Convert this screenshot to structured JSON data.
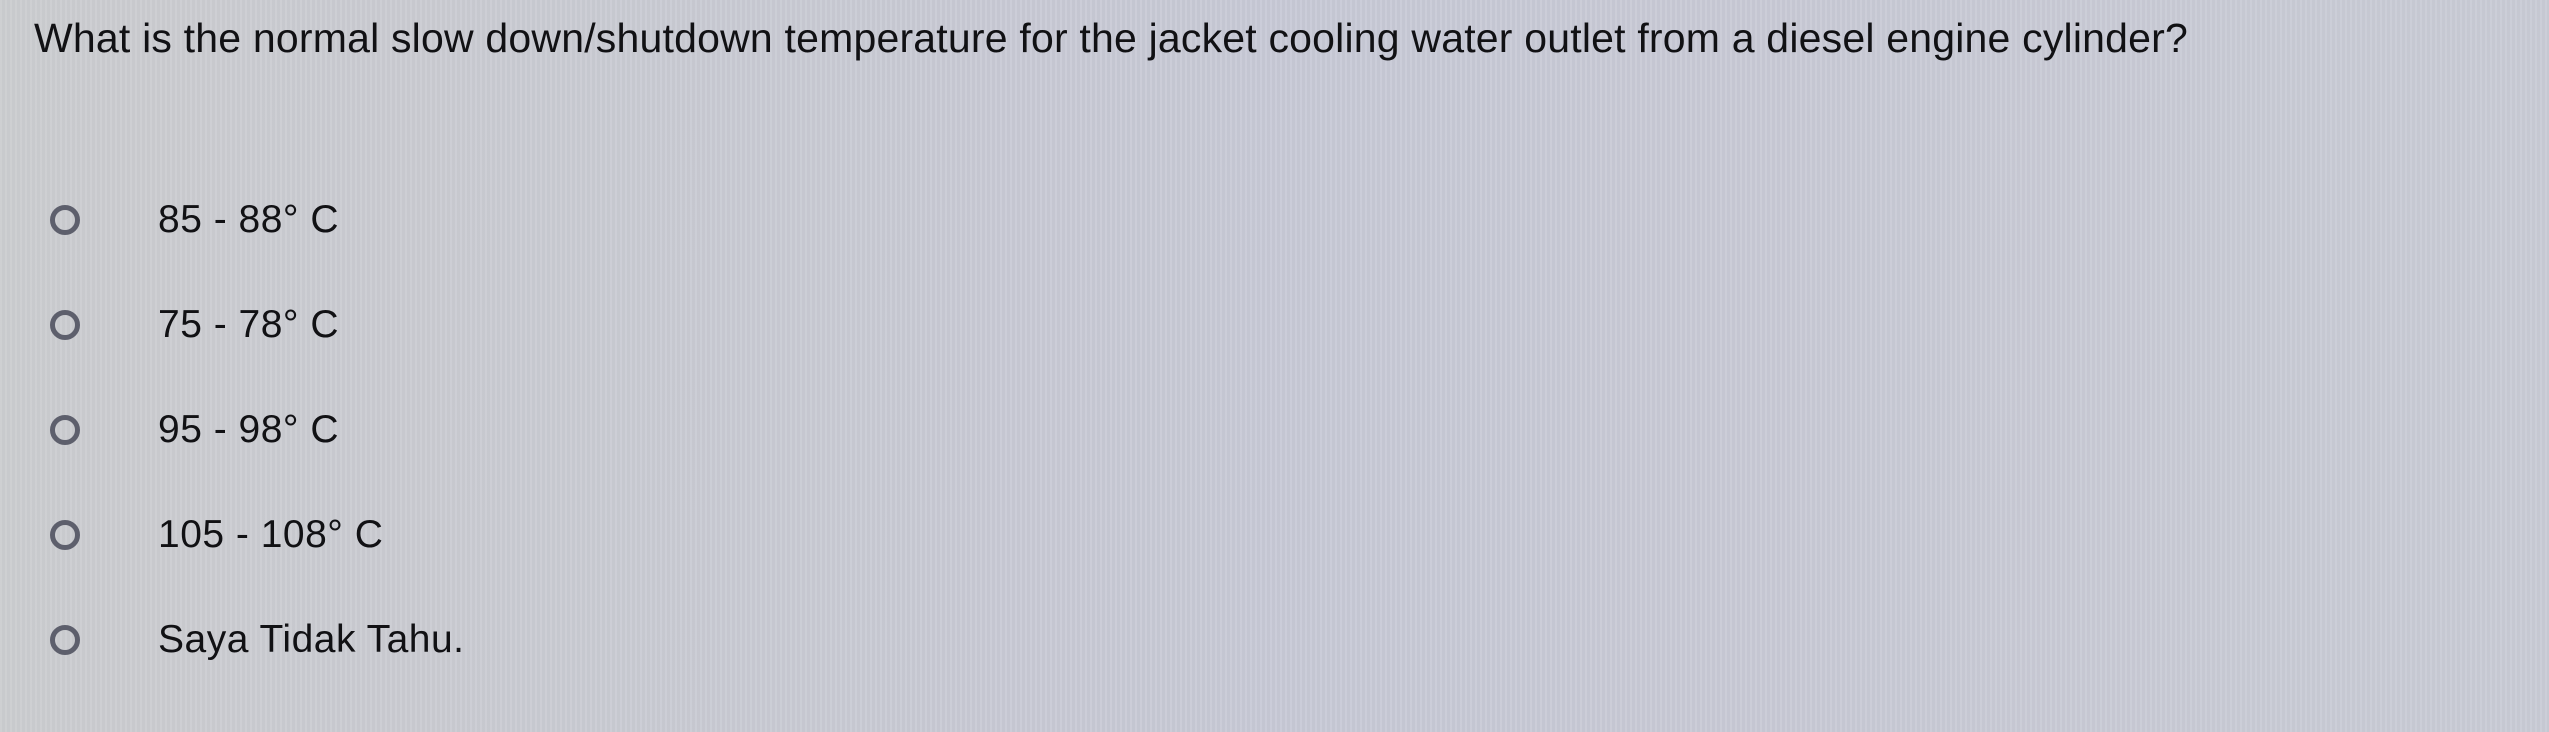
{
  "quiz": {
    "question": "What is the normal slow down/shutdown temperature for the jacket cooling water outlet from a diesel engine cylinder?",
    "options": [
      {
        "label": "85 - 88° C",
        "selected": false,
        "icon": "radio-unchecked-icon"
      },
      {
        "label": "75 - 78° C",
        "selected": false,
        "icon": "radio-unchecked-icon"
      },
      {
        "label": "95 - 98° C",
        "selected": false,
        "icon": "radio-unchecked-icon"
      },
      {
        "label": "105 - 108° C",
        "selected": false,
        "icon": "radio-unchecked-icon"
      },
      {
        "label": "Saya Tidak Tahu.",
        "selected": false,
        "icon": "radio-unchecked-icon"
      }
    ]
  }
}
